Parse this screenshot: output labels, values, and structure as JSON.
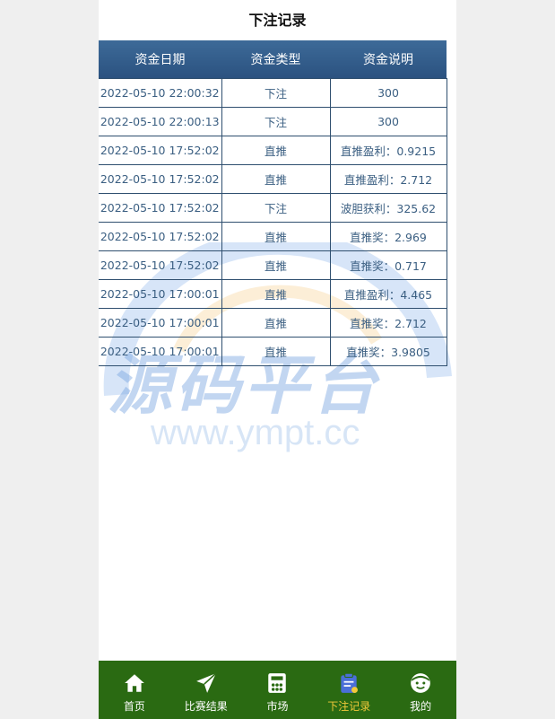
{
  "header": {
    "title": "下注记录"
  },
  "table": {
    "columns": [
      "资金日期",
      "资金类型",
      "资金说明"
    ],
    "rows": [
      [
        "2022-05-10 22:00:32",
        "下注",
        "300"
      ],
      [
        "2022-05-10 22:00:13",
        "下注",
        "300"
      ],
      [
        "2022-05-10 17:52:02",
        "直推",
        "直推盈利：0.9215"
      ],
      [
        "2022-05-10 17:52:02",
        "直推",
        "直推盈利：2.712"
      ],
      [
        "2022-05-10 17:52:02",
        "下注",
        "波胆获利：325.62"
      ],
      [
        "2022-05-10 17:52:02",
        "直推",
        "直推奖：2.969"
      ],
      [
        "2022-05-10 17:52:02",
        "直推",
        "直推奖：0.717"
      ],
      [
        "2022-05-10 17:00:01",
        "直推",
        "直推盈利：4.465"
      ],
      [
        "2022-05-10 17:00:01",
        "直推",
        "直推奖：2.712"
      ],
      [
        "2022-05-10 17:00:01",
        "直推",
        "直推奖：3.9805"
      ]
    ]
  },
  "watermark": {
    "main": "源码平台",
    "url": "www.ympt.cc"
  },
  "tabbar": {
    "items": [
      {
        "label": "首页",
        "icon": "home-icon"
      },
      {
        "label": "比赛结果",
        "icon": "paper-plane-icon"
      },
      {
        "label": "市场",
        "icon": "market-icon"
      },
      {
        "label": "下注记录",
        "icon": "clipboard-icon",
        "active": true
      },
      {
        "label": "我的",
        "icon": "face-icon"
      }
    ],
    "active_color": "#f3c93a",
    "background": "#2a6a12"
  }
}
